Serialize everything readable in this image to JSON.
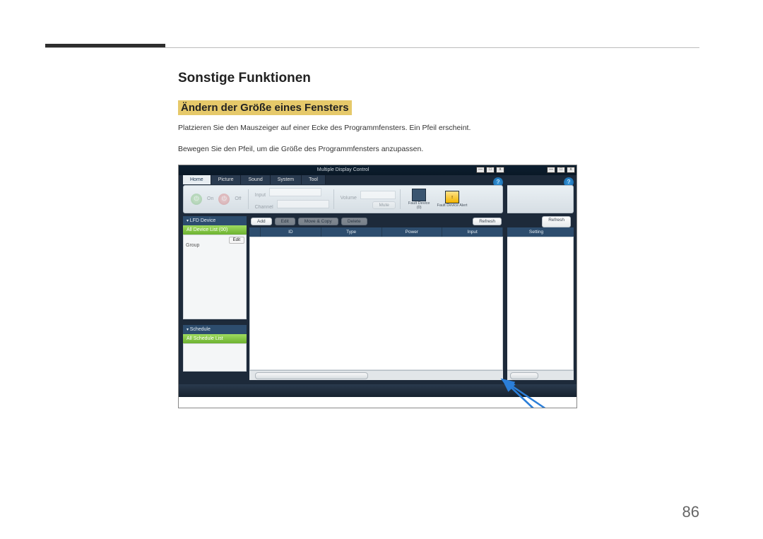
{
  "page": {
    "number": "86",
    "heading": "Sonstige Funktionen",
    "subheading": "Ändern der Größe eines Fensters",
    "paragraph1": "Platzieren Sie den Mauszeiger auf einer Ecke des Programmfensters. Ein Pfeil erscheint.",
    "paragraph2": "Bewegen Sie den Pfeil, um die Größe des Programmfensters anzupassen."
  },
  "app": {
    "title": "Multiple Display Control",
    "tabs": {
      "home": "Home",
      "picture": "Picture",
      "sound": "Sound",
      "system": "System",
      "tool": "Tool"
    },
    "toolbar": {
      "on": "On",
      "off": "Off",
      "input_label": "Input",
      "channel_label": "Channel",
      "volume_label": "Volume",
      "mute": "Mute",
      "fault_device": "Fault Device",
      "fault_count": "(0)",
      "fault_alert": "Fault Device Alert"
    },
    "buttons": {
      "add": "Add",
      "edit": "Edit",
      "move_copy": "Move & Copy",
      "delete": "Delete",
      "refresh": "Refresh"
    },
    "sidebar": {
      "lfd_header": "LFD Device",
      "all_device_list": "All Device List (00)",
      "group": "Group",
      "edit": "Edit",
      "schedule_header": "Schedule",
      "all_schedule_list": "All Schedule List"
    },
    "columns": {
      "id": "ID",
      "type": "Type",
      "power": "Power",
      "input": "Input",
      "setting": "Setting"
    },
    "window_controls": {
      "min": "—",
      "max": "□",
      "close": "x"
    },
    "help": "?"
  }
}
